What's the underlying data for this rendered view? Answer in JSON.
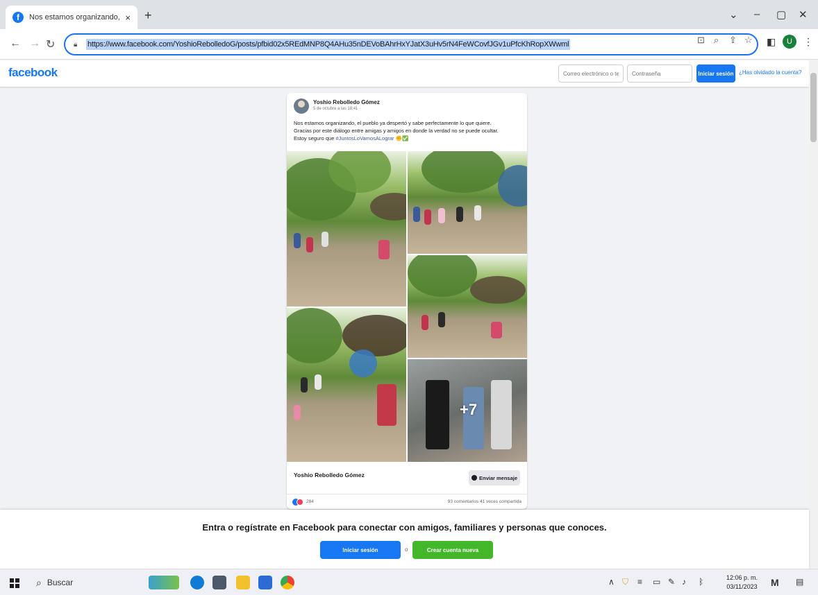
{
  "browser": {
    "tab_title": "Nos estamos organizando, el...",
    "tab_close": "×",
    "new_tab": "+",
    "url": "https://www.facebook.com/YoshioRebolledoG/posts/pfbid02x5REdMNP8Q4AHu35nDEVoBAhrHxYJatX3uHv5rN4FeWCovfJGv1uPfcKhRopXWwml",
    "profile_initial": "U"
  },
  "fb_header": {
    "logo": "facebook",
    "email_placeholder": "Correo electrónico o tel",
    "password_placeholder": "Contraseña",
    "login_label": "Iniciar sesión",
    "forgot_label": "¿Has olvidado la cuenta?"
  },
  "post": {
    "author": "Yoshio Rebolledo Gómez",
    "date": "5 de octubre a las 18:41 ·",
    "text_line1": "Nos estamos organizando, el pueblo ya despertó y sabe perfectamente lo que quiere.",
    "text_line2": "Gracias por este diálogo entre amigas y amigos en donde la verdad no se puede ocultar.",
    "text_line3": "Estoy seguro que",
    "hashtag": "#JuntosLoVamosALograr",
    "more_photos": "+7",
    "signature_name": "Yoshio Rebolledo Gómez",
    "message_button": "Enviar mensaje",
    "reaction_count": "284",
    "stats": "93 comentarios  41 veces compartida"
  },
  "banner": {
    "text": "Entra o regístrate en Facebook para conectar con amigos, familiares y personas que conoces.",
    "login_label": "Iniciar sesión",
    "or": "o",
    "create_label": "Crear cuenta nueva"
  },
  "taskbar": {
    "search_label": "Buscar",
    "time": "12:06 p. m.",
    "date": "03/11/2023"
  },
  "colors": {
    "fb_blue": "#1877f2",
    "fb_green": "#42b72a",
    "omnibox_border": "#1a73e8"
  }
}
